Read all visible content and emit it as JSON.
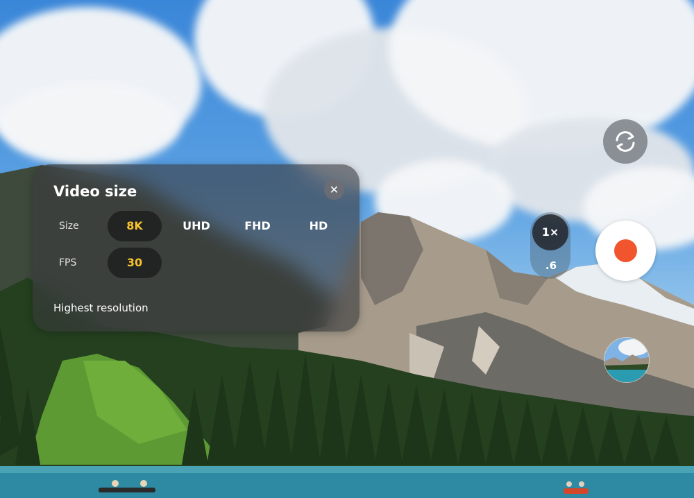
{
  "panel": {
    "title": "Video size",
    "close_icon": "close-icon",
    "size_label": "Size",
    "size_options": [
      "8K",
      "UHD",
      "FHD",
      "HD"
    ],
    "size_selected": "8K",
    "fps_label": "FPS",
    "fps_value": "30",
    "footer": "Highest resolution"
  },
  "controls": {
    "switch_camera_icon": "camera-switch-icon",
    "zoom_active": "1×",
    "zoom_alt": ".6",
    "record_icon": "record-icon",
    "gallery_icon": "gallery-thumbnail"
  },
  "colors": {
    "accent": "#f7c32e",
    "record": "#f0552e"
  }
}
